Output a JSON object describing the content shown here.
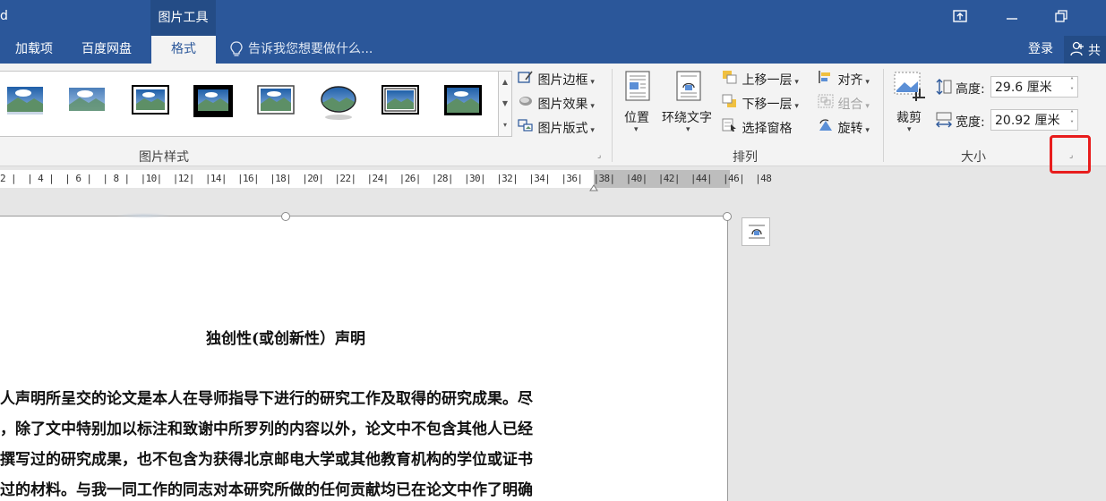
{
  "titlebar": {
    "title_fragment": "d",
    "context_tab": "图片工具"
  },
  "tabs": [
    {
      "label": "加载项"
    },
    {
      "label": "百度网盘"
    },
    {
      "label": "格式"
    }
  ],
  "tell_me": "告诉我您想要做什么...",
  "login": "登录",
  "share": "共",
  "ribbon": {
    "picture_styles_label": "图片样式",
    "border": "图片边框",
    "effects": "图片效果",
    "layout": "图片版式",
    "position": "位置",
    "wrap_text": "环绕文字",
    "bring_forward": "上移一层",
    "send_backward": "下移一层",
    "selection_pane": "选择窗格",
    "align": "对齐",
    "group": "组合",
    "rotate": "旋转",
    "arrange_label": "排列",
    "crop": "裁剪",
    "height_label": "高度:",
    "height_value": "29.6 厘米",
    "width_label": "宽度:",
    "width_value": "20.92 厘米",
    "size_label": "大小"
  },
  "ruler": "2 |  | 4 |  | 6 |  | 8 |  |10|  |12|  |14|  |16|  |18|  |20|  |22|  |24|  |26|  |28|  |30|  |32|  |34|  |36|  |38|  |40|  |42|  |44|  |46|  |48",
  "document": {
    "title": "独创性(或创新性）声明",
    "lines": [
      "人声明所呈交的论文是本人在导师指导下进行的研究工作及取得的研究成果。尽",
      "，除了文中特别加以标注和致谢中所罗列的内容以外，论文中不包含其他人已经",
      "撰写过的研究成果，也不包含为获得北京邮电大学或其他教育机构的学位或证书",
      "过的材料。与我一同工作的同志对本研究所做的任何贡献均已在论文中作了明确"
    ]
  },
  "colors": {
    "titlebar": "#2b579a",
    "ribbon": "#f3f3f3",
    "highlight": "#e81d1d"
  }
}
